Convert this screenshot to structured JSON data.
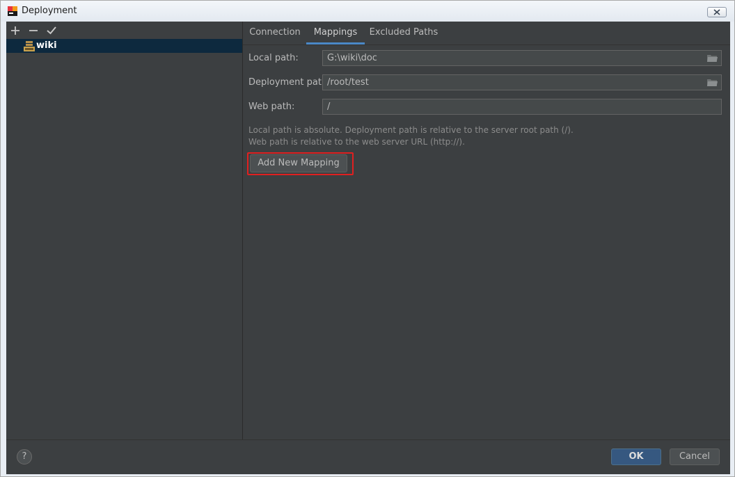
{
  "window": {
    "title": "Deployment",
    "app_icon": "intellij-app-icon",
    "close_icon": "close-icon"
  },
  "left_panel": {
    "toolbar": {
      "add_icon": "plus-icon",
      "remove_icon": "minus-icon",
      "apply_icon": "check-icon"
    },
    "tree": {
      "items": [
        {
          "label": "wiki",
          "icon": "sftp-server-icon",
          "selected": true
        }
      ]
    }
  },
  "tabs": [
    {
      "label": "Connection",
      "active": false
    },
    {
      "label": "Mappings",
      "active": true
    },
    {
      "label": "Excluded Paths",
      "active": false
    }
  ],
  "mappings": {
    "local_path_label": "Local path:",
    "local_path_value": "G:\\wiki\\doc",
    "deployment_path_label": "Deployment path:",
    "deployment_path_value": "/root/test",
    "web_path_label": "Web path:",
    "web_path_value": "/",
    "hint_line1": "Local path is absolute. Deployment path is relative to the server root path (/).",
    "hint_line2": "Web path is relative to the web server URL (http://).",
    "add_button_label": "Add New Mapping"
  },
  "footer": {
    "help_label": "?",
    "ok_label": "OK",
    "cancel_label": "Cancel"
  },
  "colors": {
    "background": "#3c3f41",
    "selection": "#0d293e",
    "accent": "#4a88c7",
    "highlight_box": "#e02020",
    "ok_button": "#365880"
  }
}
